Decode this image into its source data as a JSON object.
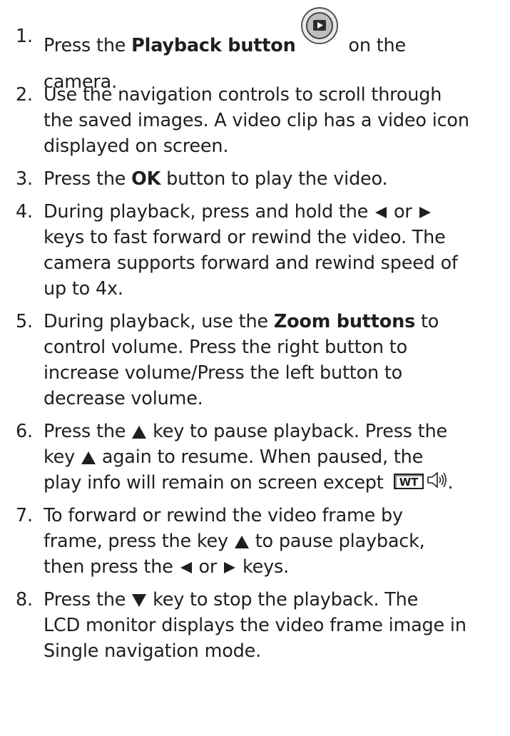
{
  "steps": [
    {
      "number": "1.",
      "lines": [
        [
          "Press the ",
          "Playback button",
          " on the"
        ],
        [
          "camera."
        ]
      ],
      "icon": "playback-button-icon"
    },
    {
      "number": "2.",
      "lines": [
        "Use the navigation controls to scroll through",
        "the saved images. A video clip has a video icon",
        "displayed on screen."
      ]
    },
    {
      "number": "3.",
      "lines": [
        [
          "Press the ",
          "OK",
          " button to play the video."
        ]
      ]
    },
    {
      "number": "4.",
      "lines": [
        [
          "During playback, press and hold the ",
          " or "
        ],
        "keys to fast forward or rewind the video. The",
        "camera supports forward and rewind speed of",
        "up to 4x."
      ],
      "icons": [
        "left-arrow-icon",
        "right-arrow-icon"
      ]
    },
    {
      "number": "5.",
      "lines": [
        [
          "During playback, use the ",
          "Zoom buttons",
          " to"
        ],
        "control volume. Press the right button to",
        "increase volume/Press the left button to",
        "decrease volume."
      ]
    },
    {
      "number": "6.",
      "lines": [
        [
          "Press the ",
          " key to pause playback. Press the"
        ],
        [
          "key ",
          " again to resume. When paused, the"
        ],
        [
          "play info will remain on screen except ",
          "."
        ]
      ],
      "icons": [
        "up-arrow-icon",
        "wt-zoom-icon",
        "speaker-icon"
      ],
      "wt_label": "WT"
    },
    {
      "number": "7.",
      "lines": [
        "To forward or rewind the video frame by",
        [
          "frame, press the key ",
          " to pause playback,"
        ],
        [
          "then press the ",
          " or ",
          " keys."
        ]
      ],
      "icons": [
        "up-arrow-icon",
        "left-arrow-icon",
        "right-arrow-icon"
      ]
    },
    {
      "number": "8.",
      "lines": [
        [
          "Press the ",
          " key to stop the playback. The"
        ],
        "LCD monitor displays the video frame image in",
        "Single navigation mode."
      ],
      "icons": [
        "down-arrow-icon"
      ]
    }
  ]
}
